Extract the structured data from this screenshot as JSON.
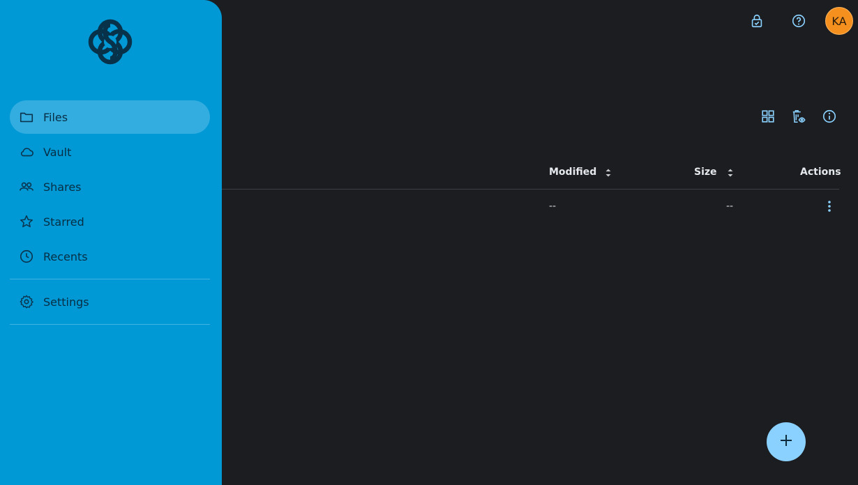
{
  "sidebar": {
    "items": [
      {
        "label": "Files",
        "icon": "folder-icon",
        "active": true
      },
      {
        "label": "Vault",
        "icon": "cloud-icon"
      },
      {
        "label": "Shares",
        "icon": "people-icon"
      },
      {
        "label": "Starred",
        "icon": "star-icon"
      },
      {
        "label": "Recents",
        "icon": "clock-icon"
      }
    ],
    "settings": {
      "label": "Settings",
      "icon": "gear-icon"
    }
  },
  "header": {
    "avatar_initials": "KA",
    "icons": [
      "lock-check-icon",
      "help-icon"
    ]
  },
  "toolbar": {
    "icons": [
      "grid-view-icon",
      "trash-view-icon",
      "info-icon"
    ]
  },
  "table": {
    "columns": {
      "modified": "Modified",
      "size": "Size",
      "actions": "Actions"
    },
    "rows": [
      {
        "modified": "--",
        "size": "--"
      }
    ]
  },
  "fab": {
    "icon": "plus-icon"
  },
  "colors": {
    "sidebar": "#0099d5",
    "background": "#1b1d20",
    "accent_icon": "#8bd1ff",
    "avatar": "#f5901f"
  }
}
